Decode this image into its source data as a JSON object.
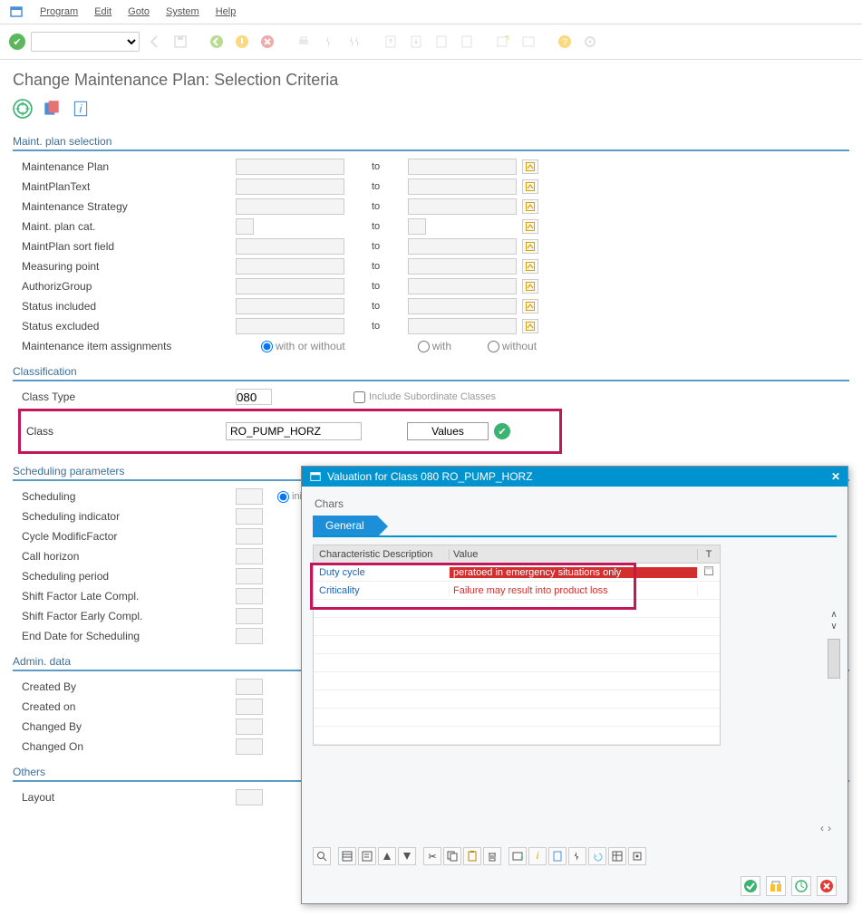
{
  "menu": {
    "program": "Program",
    "edit": "Edit",
    "goto": "Goto",
    "system": "System",
    "help": "Help"
  },
  "page_title": "Change Maintenance Plan: Selection Criteria",
  "groups": {
    "sel": {
      "title": "Maint. plan selection",
      "rows": [
        {
          "label": "Maintenance Plan",
          "to": "to"
        },
        {
          "label": "MaintPlanText",
          "to": "to"
        },
        {
          "label": "Maintenance Strategy",
          "to": "to"
        },
        {
          "label": "Maint. plan cat.",
          "to": "to",
          "small": true
        },
        {
          "label": "MaintPlan sort field",
          "to": "to"
        },
        {
          "label": "Measuring point",
          "to": "to"
        },
        {
          "label": "AuthorizGroup",
          "to": "to"
        },
        {
          "label": "Status included",
          "to": "to"
        },
        {
          "label": "Status excluded",
          "to": "to"
        }
      ],
      "assignments": {
        "label": "Maintenance item assignments",
        "r1": "with or without",
        "r2": "with",
        "r3": "without"
      }
    },
    "class": {
      "title": "Classification",
      "type_label": "Class Type",
      "type_val": "080",
      "subord_label": "Include Subordinate Classes",
      "class_label": "Class",
      "class_val": "RO_PUMP_HORZ",
      "values_btn": "Values"
    },
    "sched": {
      "title": "Scheduling parameters",
      "rows": [
        "Scheduling",
        "Scheduling indicator",
        "Cycle ModificFactor",
        "Call horizon",
        "Scheduling period",
        "Shift Factor Late Compl.",
        "Shift Factor Early Compl.",
        "End Date for Scheduling"
      ],
      "sched_radio": "initial or"
    },
    "admin": {
      "title": "Admin. data",
      "rows": [
        "Created By",
        "Created on",
        "Changed By",
        "Changed On"
      ]
    },
    "others": {
      "title": "Others",
      "rows": [
        "Layout"
      ]
    }
  },
  "popup": {
    "title": "Valuation for Class 080 RO_PUMP_HORZ",
    "chars_label": "Chars",
    "tab": "General",
    "head": {
      "c1": "Characteristic Description",
      "c2": "Value",
      "c3": "T"
    },
    "rows": [
      {
        "c1": "Duty cycle",
        "c2": "peratoed in emergency situations only",
        "hl": "bg"
      },
      {
        "c1": "Criticality",
        "c2": "Failure may result into product loss",
        "hl": "txt"
      }
    ]
  }
}
